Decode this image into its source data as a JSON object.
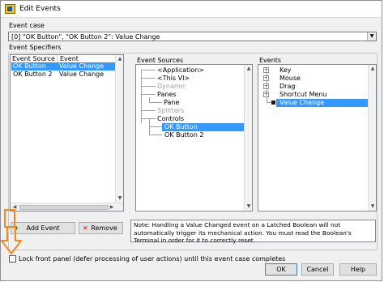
{
  "window": {
    "title": "Edit Events"
  },
  "event_case": {
    "label": "Event case",
    "value": "[0] \"OK Button\", \"OK Button 2\": Value Change"
  },
  "event_specifiers": {
    "label": "Event Specifiers",
    "columns": [
      "Event Source",
      "Event"
    ],
    "rows": [
      {
        "source": "OK Button",
        "event": "Value Change",
        "selected": true
      },
      {
        "source": "OK Button 2",
        "event": "Value Change",
        "selected": false
      }
    ],
    "add_button": "Add Event",
    "add_icon": "plus-icon",
    "remove_button": "Remove",
    "remove_icon": "x-icon"
  },
  "event_sources": {
    "label": "Event Sources",
    "items": [
      {
        "text": "<Application>",
        "disabled": false
      },
      {
        "text": "<This VI>",
        "disabled": false
      },
      {
        "text": "Dynamic",
        "disabled": true
      },
      {
        "text": "Panes",
        "disabled": false
      },
      {
        "text": "Pane",
        "disabled": false
      },
      {
        "text": "Splitters",
        "disabled": true
      },
      {
        "text": "Controls",
        "disabled": false
      },
      {
        "text": "OK Button",
        "disabled": false,
        "selected": true
      },
      {
        "text": "OK Button 2",
        "disabled": false
      }
    ]
  },
  "events": {
    "label": "Events",
    "items": [
      {
        "text": "Key",
        "expander": "+"
      },
      {
        "text": "Mouse",
        "expander": "+"
      },
      {
        "text": "Drag",
        "expander": "+"
      },
      {
        "text": "Shortcut Menu",
        "expander": "+"
      },
      {
        "text": "Value Change",
        "selected": true
      }
    ]
  },
  "note": "Note:  Handling a Value Changed event on a Latched Boolean will not automatically trigger its mechanical action. You must read the Boolean's Terminal in order for it to correctly reset.",
  "lock_panel": {
    "label": "Lock front panel (defer processing of user actions) until this event case completes",
    "checked": false
  },
  "buttons": {
    "ok": "OK",
    "cancel": "Cancel",
    "help": "Help"
  },
  "colors": {
    "selection": "#3399ff",
    "annotation": "#f28a1c"
  }
}
